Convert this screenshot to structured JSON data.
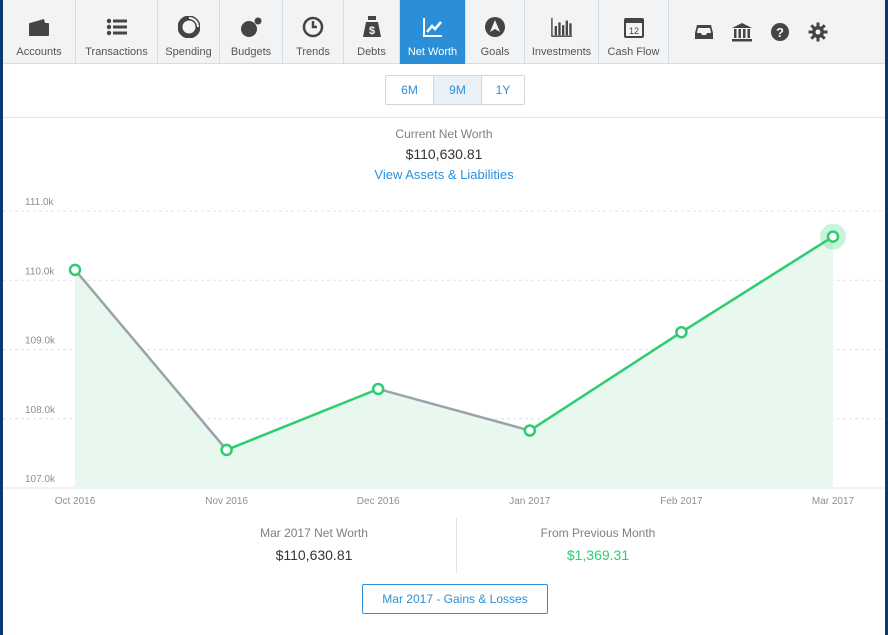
{
  "nav": {
    "items": [
      {
        "label": "Accounts",
        "icon": "wallet-icon",
        "active": false
      },
      {
        "label": "Transactions",
        "icon": "list-icon",
        "active": false
      },
      {
        "label": "Spending",
        "icon": "donut-chart-icon",
        "active": false
      },
      {
        "label": "Budgets",
        "icon": "budget-icon",
        "active": false
      },
      {
        "label": "Trends",
        "icon": "clock-icon",
        "active": false
      },
      {
        "label": "Debts",
        "icon": "money-bag-icon",
        "active": false
      },
      {
        "label": "Net Worth",
        "icon": "line-chart-icon",
        "active": true
      },
      {
        "label": "Goals",
        "icon": "compass-icon",
        "active": false
      },
      {
        "label": "Investments",
        "icon": "bar-chart-icon",
        "active": false
      },
      {
        "label": "Cash Flow",
        "icon": "calendar-icon",
        "active": false
      }
    ],
    "right_icons": [
      "inbox-icon",
      "bank-icon",
      "help-icon",
      "gear-icon"
    ]
  },
  "range": {
    "options": [
      "6M",
      "9M",
      "1Y"
    ],
    "selected": "9M"
  },
  "header": {
    "label": "Current Net Worth",
    "value": "$110,630.81",
    "link": "View Assets & Liabilities"
  },
  "chart_data": {
    "type": "area",
    "categories": [
      "Oct 2016",
      "Nov 2016",
      "Dec 2016",
      "Jan 2017",
      "Feb 2017",
      "Mar 2017"
    ],
    "values": [
      110150,
      107550,
      108430,
      107830,
      109250,
      110630.81
    ],
    "y_ticks": [
      "111.0k",
      "110.0k",
      "109.0k",
      "108.0k",
      "107.0k"
    ],
    "ylim": [
      107000,
      111000
    ],
    "colors": {
      "up": "#2ecc71",
      "down": "#9aa3ab",
      "fill": "#e8f8ee"
    },
    "grid": true
  },
  "summary": {
    "left_label": "Mar 2017 Net Worth",
    "left_value": "$110,630.81",
    "right_label": "From Previous Month",
    "right_value": "$1,369.31"
  },
  "gains_button": "Mar 2017 - Gains & Losses"
}
